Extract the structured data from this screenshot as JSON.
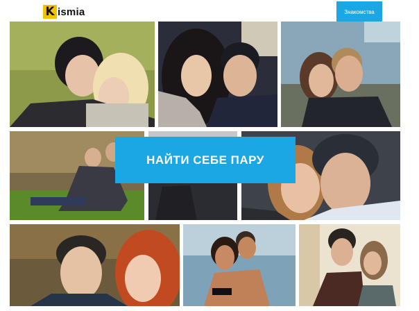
{
  "header": {
    "logo_initial": "K",
    "logo_rest": "ismia",
    "nav_button": "Знакомства"
  },
  "hero": {
    "cta_label": "НАЙТИ СЕБЕ ПАРУ"
  },
  "colors": {
    "accent": "#1ba6e4",
    "logo_badge": "#f2c200"
  }
}
